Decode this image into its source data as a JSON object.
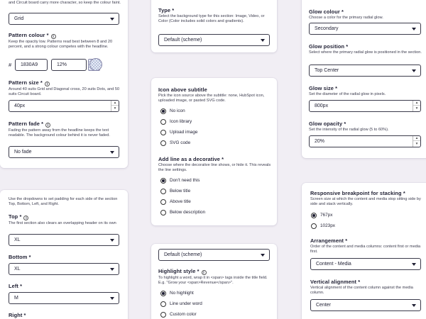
{
  "c1": {
    "top_help": "and Circuit board carry more character, so keep the colour faint.",
    "pattern_select": "Grid",
    "pattern_colour": {
      "label": "Pattern colour *",
      "help": "Keep the opacity low. Patterns read best between 8 and 20 percent, and a strong colour competes with the headline.",
      "hash": "#",
      "hex": "1830A9",
      "opacity": "12%"
    },
    "pattern_size": {
      "label": "Pattern size *",
      "help": "Around 40 suits Grid and Diagonal cross, 20 suits Dots, and 50 suits Circuit board.",
      "value": "40px"
    },
    "pattern_fade": {
      "label": "Pattern fade *",
      "help": "Fading the pattern away from the headline keeps the text readable. The background colour behind it is never faded.",
      "value": "No fade"
    }
  },
  "c2": {
    "type": {
      "label": "Type *",
      "help": "Select the background type for this section: Image, Video, or Color (Color includes solid colors and gradients).",
      "value": "Default (scheme)"
    }
  },
  "c3": {
    "glow_colour": {
      "label": "Glow colour *",
      "help": "Choose a color for the primary radial glow.",
      "value": "Secondary"
    },
    "glow_position": {
      "label": "Glow position *",
      "help": "Select where the primary radial glow is positioned in the section.",
      "value": "Top Center"
    },
    "glow_size": {
      "label": "Glow size *",
      "help": "Set the diameter of the radial glow in pixels.",
      "value": "800px"
    },
    "glow_opacity": {
      "label": "Glow opacity *",
      "help": "Set the intensity of the radial glow (5 to 60%).",
      "value": "20%"
    }
  },
  "c4": {
    "icon": {
      "label": "Icon above subtitle",
      "help": "Pick the icon source above the subtitle: none, HubSpot icon, uploaded image, or pasted SVG code.",
      "options": [
        "No icon",
        "Icon library",
        "Upload image",
        "SVG code"
      ],
      "selected": 0
    },
    "line": {
      "label": "Add line as a decorative *",
      "help": "Choose where the decorative line shows, or hide it. This reveals the line settings.",
      "options": [
        "Don't need this",
        "Below title",
        "Above title",
        "Below description"
      ],
      "selected": 0
    }
  },
  "c5": {
    "intro": "Use the dropdowns to set padding for each side of the section Top, Bottom, Left, and Right.",
    "top": {
      "label": "Top *",
      "help": "The first section also clears an overlapping header on its own",
      "value": "XL"
    },
    "bottom": {
      "label": "Bottom *",
      "value": "XL"
    },
    "left": {
      "label": "Left *",
      "value": "M"
    },
    "right": {
      "label": "Right *"
    }
  },
  "c6": {
    "select": "Default (scheme)",
    "highlight": {
      "label": "Highlight style *",
      "help": "To highlight a word, wrap it in <span> tags inside the title field. E.g. \"Grow your <span>Revenue</span>\".",
      "options": [
        "No highlight",
        "Line under word",
        "Custom color"
      ],
      "selected": 0
    }
  },
  "c7": {
    "breakpoint": {
      "label": "Responsive breakpoint for stacking *",
      "help": "Screen size at which the content and media stop sitting side by side and stack vertically.",
      "options": [
        "767px",
        "1023px"
      ],
      "selected": 0
    },
    "arrangement": {
      "label": "Arrangement *",
      "help": "Order of the content and media columns: content first or media first.",
      "value": "Content - Media"
    },
    "vertical": {
      "label": "Vertical alignment *",
      "help": "Vertical alignment of the content column against the media column.",
      "value": "Center"
    }
  }
}
